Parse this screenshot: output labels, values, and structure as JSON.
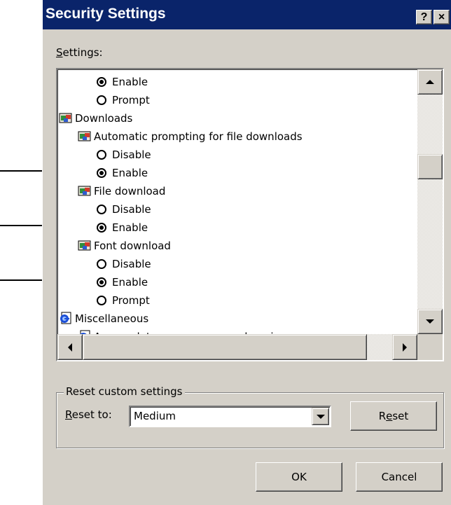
{
  "dialog": {
    "title": "Security Settings",
    "help_glyph": "?",
    "close_glyph": "×"
  },
  "settings_label": {
    "mnemonic": "S",
    "rest": "ettings:"
  },
  "tree": [
    {
      "kind": "radio",
      "checked": true,
      "label": "Enable",
      "indent": 2
    },
    {
      "kind": "radio",
      "checked": false,
      "label": "Prompt",
      "indent": 2
    },
    {
      "kind": "category",
      "icon": "settings-folder-icon",
      "label": "Downloads",
      "indent": 0
    },
    {
      "kind": "setting",
      "icon": "settings-folder-icon",
      "label": "Automatic prompting for file downloads",
      "indent": 1
    },
    {
      "kind": "radio",
      "checked": false,
      "label": "Disable",
      "indent": 2
    },
    {
      "kind": "radio",
      "checked": true,
      "label": "Enable",
      "indent": 2
    },
    {
      "kind": "setting",
      "icon": "settings-folder-icon",
      "label": "File download",
      "indent": 1
    },
    {
      "kind": "radio",
      "checked": false,
      "label": "Disable",
      "indent": 2
    },
    {
      "kind": "radio",
      "checked": true,
      "label": "Enable",
      "indent": 2
    },
    {
      "kind": "setting",
      "icon": "settings-folder-icon",
      "label": "Font download",
      "indent": 1
    },
    {
      "kind": "radio",
      "checked": false,
      "label": "Disable",
      "indent": 2
    },
    {
      "kind": "radio",
      "checked": true,
      "label": "Enable",
      "indent": 2
    },
    {
      "kind": "radio",
      "checked": false,
      "label": "Prompt",
      "indent": 2
    },
    {
      "kind": "category",
      "icon": "ie-page-icon",
      "label": "Miscellaneous",
      "indent": 0
    },
    {
      "kind": "setting",
      "icon": "ie-page-icon",
      "label": "Access data sources across domains",
      "indent": 1
    }
  ],
  "reset_group": {
    "legend": "Reset custom settings",
    "reset_to_mnemonic": "R",
    "reset_to_rest": "eset to:",
    "selected_level": "Medium",
    "reset_btn_pre": "R",
    "reset_btn_mnemonic": "e",
    "reset_btn_post": "set"
  },
  "buttons": {
    "ok": "OK",
    "cancel": "Cancel"
  },
  "colors": {
    "titlebar": "#0a246a",
    "face": "#d4d0c8",
    "list_bg": "#ffffff"
  }
}
